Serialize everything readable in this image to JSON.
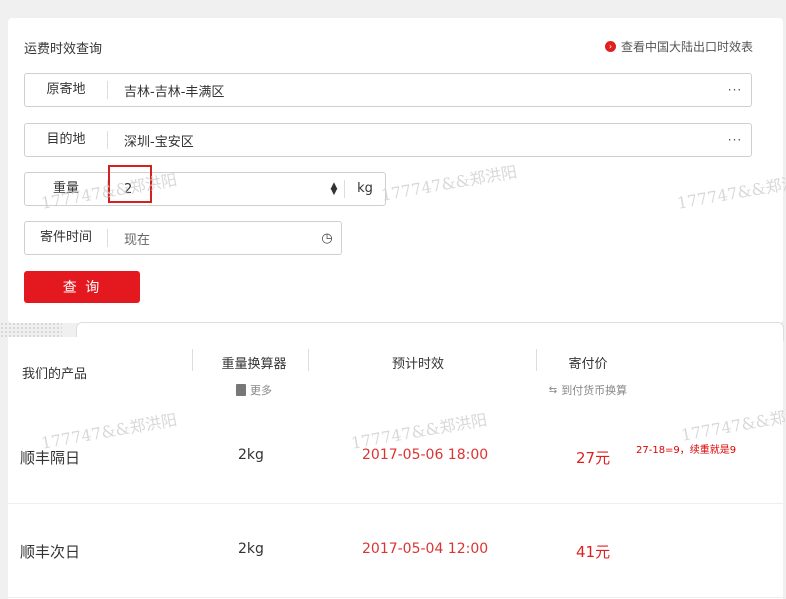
{
  "form": {
    "title": "运费时效查询",
    "top_link": "查看中国大陆出口时效表",
    "origin": {
      "label": "原寄地",
      "value": "吉林-吉林-丰满区"
    },
    "destination": {
      "label": "目的地",
      "value": "深圳-宝安区"
    },
    "weight": {
      "label": "重量",
      "value": "2",
      "unit": "kg"
    },
    "time": {
      "label": "寄件时间",
      "placeholder": "现在"
    },
    "query_button": "查 询",
    "more_icon": "···"
  },
  "watermark": "177747&&郑洪阳",
  "table": {
    "headers": {
      "product": "我们的产品",
      "converter": "重量换算器",
      "converter_sub": "更多",
      "eta": "预计时效",
      "price": "寄付价",
      "price_sub": "到付货币换算"
    },
    "rows": [
      {
        "name": "顺丰隔日",
        "weight": "2kg",
        "time": "2017-05-06 18:00",
        "price": "27元",
        "note": "27-18=9，续重就是9"
      },
      {
        "name": "顺丰次日",
        "weight": "2kg",
        "time": "2017-05-04 12:00",
        "price": "41元",
        "note": ""
      }
    ]
  },
  "colors": {
    "accent": "#e4181f",
    "time_text": "#d33333"
  }
}
